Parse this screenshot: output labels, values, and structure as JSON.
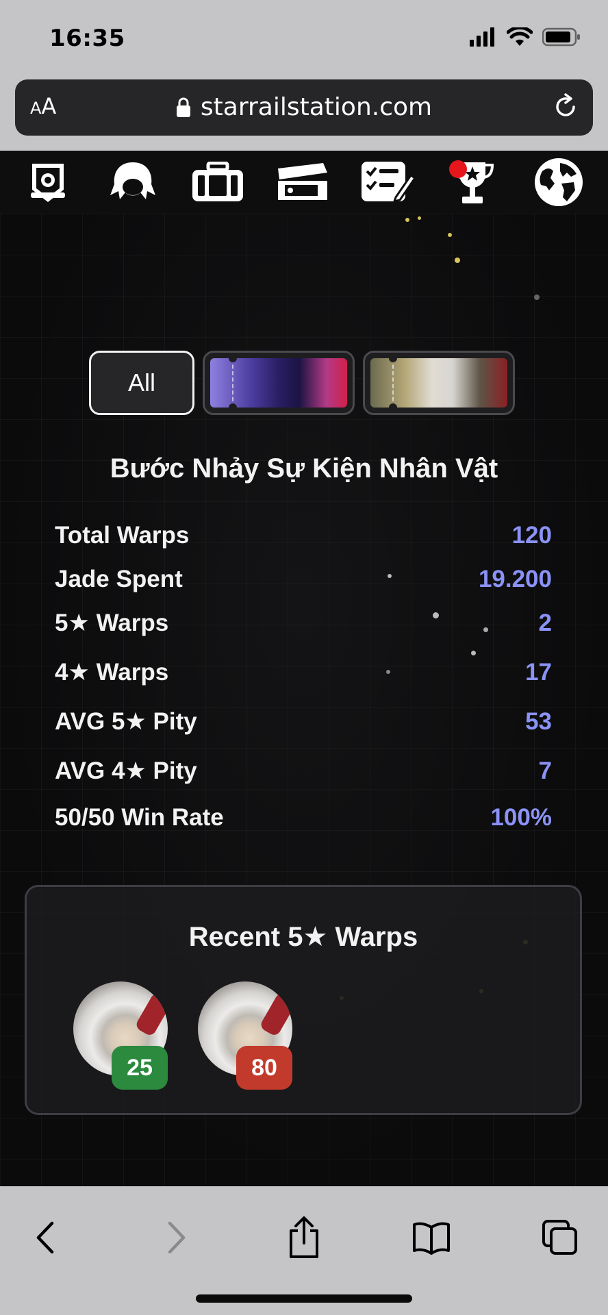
{
  "status_bar": {
    "time": "16:35"
  },
  "browser": {
    "text_size_small": "A",
    "text_size_big": "A",
    "url": "starrailstation.com"
  },
  "nav": {
    "icons": [
      "pass-icon",
      "character-icon",
      "inventory-icon",
      "warp-ticket-icon",
      "checklist-icon",
      "trophy-icon",
      "globe-icon"
    ],
    "notification_on": "trophy-icon"
  },
  "banner_tabs": {
    "all_label": "All",
    "selected": "All"
  },
  "banner_title": "Bước Nhảy Sự Kiện Nhân Vật",
  "stats": [
    {
      "label": "Total Warps",
      "value": "120"
    },
    {
      "label": "Jade Spent",
      "value": "19.200"
    },
    {
      "label": "5★ Warps",
      "value": "2"
    },
    {
      "label": "4★ Warps",
      "value": "17"
    },
    {
      "label": "AVG 5★ Pity",
      "value": "53"
    },
    {
      "label": "AVG 4★ Pity",
      "value": "7"
    },
    {
      "label": "50/50 Win Rate",
      "value": "100%"
    }
  ],
  "recent": {
    "title": "Recent 5★ Warps",
    "items": [
      {
        "pity": "25",
        "badge_color": "#2b8a3e"
      },
      {
        "pity": "80",
        "badge_color": "#c23a2b"
      }
    ]
  },
  "colors": {
    "accent_value": "#8b92f6",
    "background": "#0c0c0d",
    "browser_chrome": "#c5c5c7"
  }
}
